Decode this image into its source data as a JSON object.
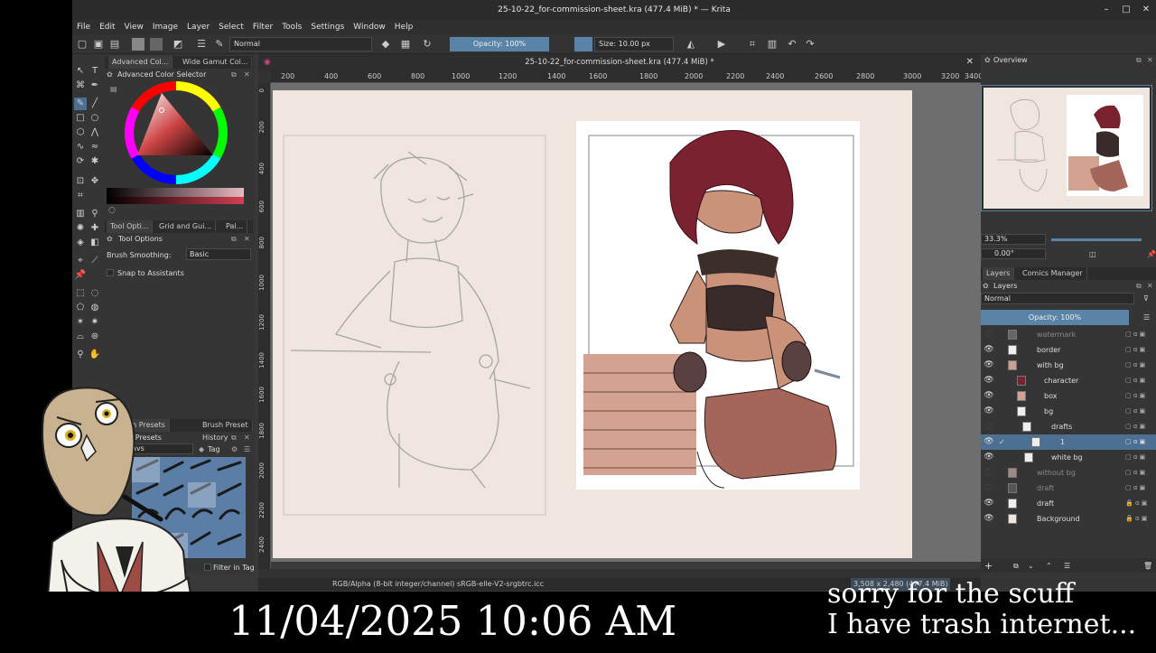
{
  "window": {
    "title": "25-10-22_for-commission-sheet.kra (477.4 MiB) * — Krita"
  },
  "menu": [
    "File",
    "Edit",
    "View",
    "Image",
    "Layer",
    "Select",
    "Filter",
    "Tools",
    "Settings",
    "Window",
    "Help"
  ],
  "toolbar": {
    "blend_mode": "Normal",
    "opacity": "Opacity: 100%",
    "size": "Size: 10.00 px"
  },
  "left_dock": {
    "color_tabs": [
      "Advanced Col...",
      "Wide Gamut Col..."
    ],
    "color_title": "Advanced Color Selector",
    "tool_tabs": [
      "Tool Opti...",
      "Grid and Gui...",
      "Pal..."
    ],
    "tool_options_title": "Tool Options",
    "brush_smoothing_label": "Brush Smoothing:",
    "brush_smoothing_value": "Basic",
    "snap_label": "Snap to Assistants",
    "preset_tabs": [
      "sh Presets",
      "Brush Preset History"
    ],
    "preset_title": "sh Presets",
    "tag_filter": "avs",
    "tag_label": "Tag",
    "filter_in_tag": "Filter in Tag"
  },
  "canvas": {
    "doc_tab": "25-10-22_for-commission-sheet.kra (477.4 MiB) *",
    "h_ticks": [
      "200",
      "400",
      "600",
      "800",
      "1000",
      "1200",
      "1400",
      "1600",
      "1800",
      "2000",
      "2200",
      "2400",
      "2600",
      "2800",
      "3000",
      "3200",
      "3400"
    ],
    "v_ticks": [
      "0",
      "200",
      "400",
      "600",
      "800",
      "1000",
      "1200",
      "1400",
      "1600",
      "1800",
      "2000",
      "2200",
      "2400"
    ],
    "colors": {
      "paper": "#efe6df",
      "box": "#d4a290",
      "hair": "#7a2230",
      "skin": "#c99279"
    }
  },
  "statusbar": {
    "color_info": "RGB/Alpha (8-bit integer/channel)  sRGB-elle-V2-srgbtrc.icc",
    "dimensions": "3,508 x 2,480 (477.4 MiB)",
    "rotation": "0.00°"
  },
  "right_dock": {
    "overview_title": "Overview",
    "zoom": "33.3%",
    "rotation": "0.00°",
    "tabs": [
      "Layers",
      "Comics Manager"
    ],
    "layers_title": "Layers",
    "blend_mode": "Normal",
    "opacity": "Opacity:  100%",
    "layers": [
      {
        "name": "watermark",
        "visible": false,
        "locked": false
      },
      {
        "name": "border",
        "visible": true,
        "locked": false
      },
      {
        "name": "with bg",
        "visible": true,
        "locked": false
      },
      {
        "name": "character",
        "visible": true,
        "locked": false
      },
      {
        "name": "box",
        "visible": true,
        "locked": false
      },
      {
        "name": "bg",
        "visible": true,
        "locked": false
      },
      {
        "name": "drafts",
        "visible": false,
        "locked": false
      },
      {
        "name": "1",
        "visible": true,
        "locked": false
      },
      {
        "name": "white bg",
        "visible": true,
        "locked": false
      },
      {
        "name": "without bg",
        "visible": false,
        "locked": false
      },
      {
        "name": "draft",
        "visible": false,
        "locked": false
      },
      {
        "name": "draft",
        "visible": true,
        "locked": true
      },
      {
        "name": "Background",
        "visible": true,
        "locked": true
      }
    ]
  },
  "overlay": {
    "datetime": "11/04/2025 10:06 AM",
    "note_line1": "sorry for the scuff",
    "note_line2": "I have trash internet..."
  }
}
